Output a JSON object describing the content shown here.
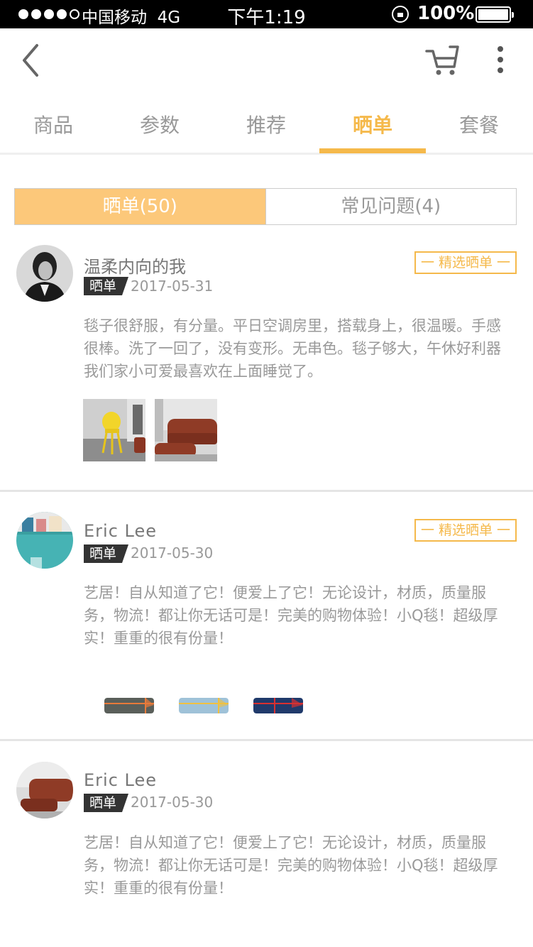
{
  "status_bar": {
    "carrier": "中国移动",
    "network": "4G",
    "time": "下午1:19",
    "battery": "100%"
  },
  "nav": {
    "back_icon": "chevron-left-icon",
    "cart_icon": "cart-icon",
    "more_icon": "more-vertical-icon"
  },
  "tabs": [
    {
      "label": "商品",
      "active": false
    },
    {
      "label": "参数",
      "active": false
    },
    {
      "label": "推荐",
      "active": false
    },
    {
      "label": "晒单",
      "active": true
    },
    {
      "label": "套餐",
      "active": false
    }
  ],
  "segment": {
    "left": "晒单(50)",
    "right": "常见问题(4)"
  },
  "colors": {
    "accent": "#F5B94B",
    "segment_active": "#FCC87A"
  },
  "reviews": [
    {
      "username": "温柔内向的我",
      "tag": "晒单",
      "date": "2017-05-31",
      "featured": "一 精选晒单 一",
      "text": "毯子很舒服，有分量。平日空调房里，搭载身上，很温暖。手感很棒。洗了一回了，没有变形。无串色。毯子够大，午休好利器我们家小可爱最喜欢在上面睡觉了。"
    },
    {
      "username": "Eric Lee",
      "tag": "晒单",
      "date": "2017-05-30",
      "featured": "一 精选晒单 一",
      "text": "艺居！自从知道了它！便爱上了它！无论设计，材质，质量服务，物流！都让你无话可是！完美的购物体验！小Q毯！超级厚实！重重的很有份量！"
    },
    {
      "username": "Eric Lee",
      "tag": "晒单",
      "date": "2017-05-30",
      "text": "艺居！自从知道了它！便爱上了它！无论设计，材质，质量服务，物流！都让你无话可是！完美的购物体验！小Q毯！超级厚实！重重的很有份量！"
    }
  ]
}
